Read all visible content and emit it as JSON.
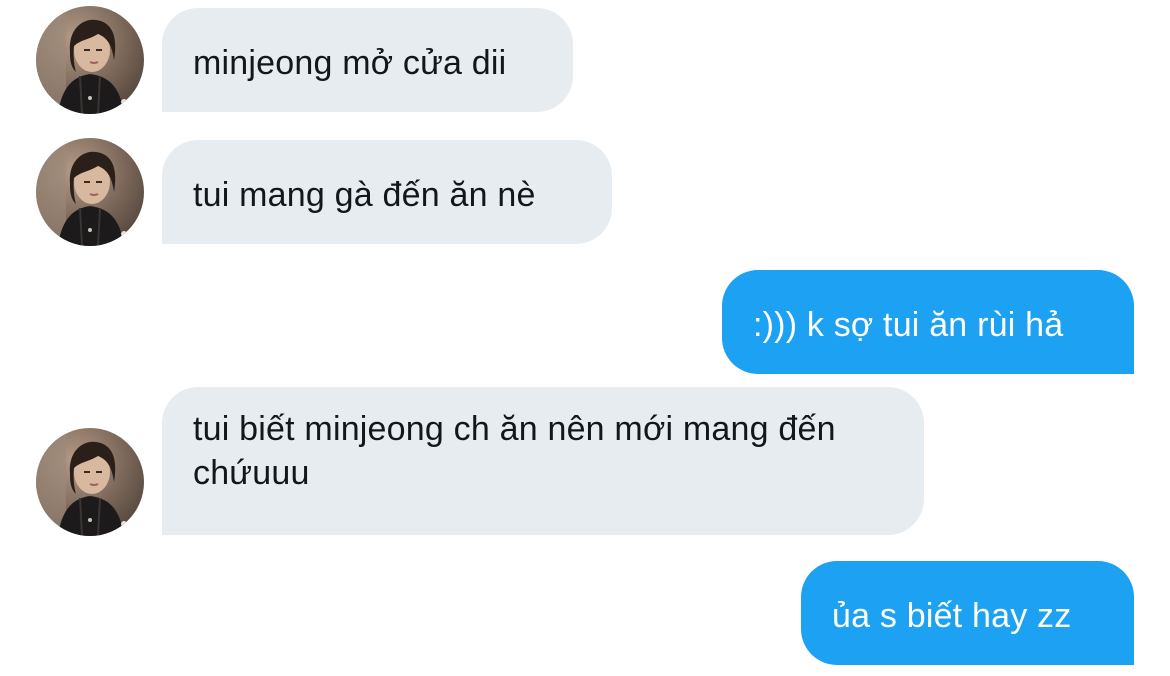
{
  "contact": {
    "avatar_icon": "profile-photo"
  },
  "colors": {
    "incoming_bubble": "#e6ecf0",
    "outgoing_bubble": "#1da1f2",
    "incoming_text": "#14171a",
    "outgoing_text": "#ffffff"
  },
  "messages": [
    {
      "direction": "incoming",
      "text": "minjeong mở cửa dii"
    },
    {
      "direction": "incoming",
      "text": "tui mang gà đến ăn nè"
    },
    {
      "direction": "outgoing",
      "text": ":))) k sợ tui ăn rùi hả"
    },
    {
      "direction": "incoming",
      "text": "tui biết minjeong ch ăn nên mới mang đến chứuuu"
    },
    {
      "direction": "outgoing",
      "text": "ủa s biết hay zz"
    }
  ]
}
